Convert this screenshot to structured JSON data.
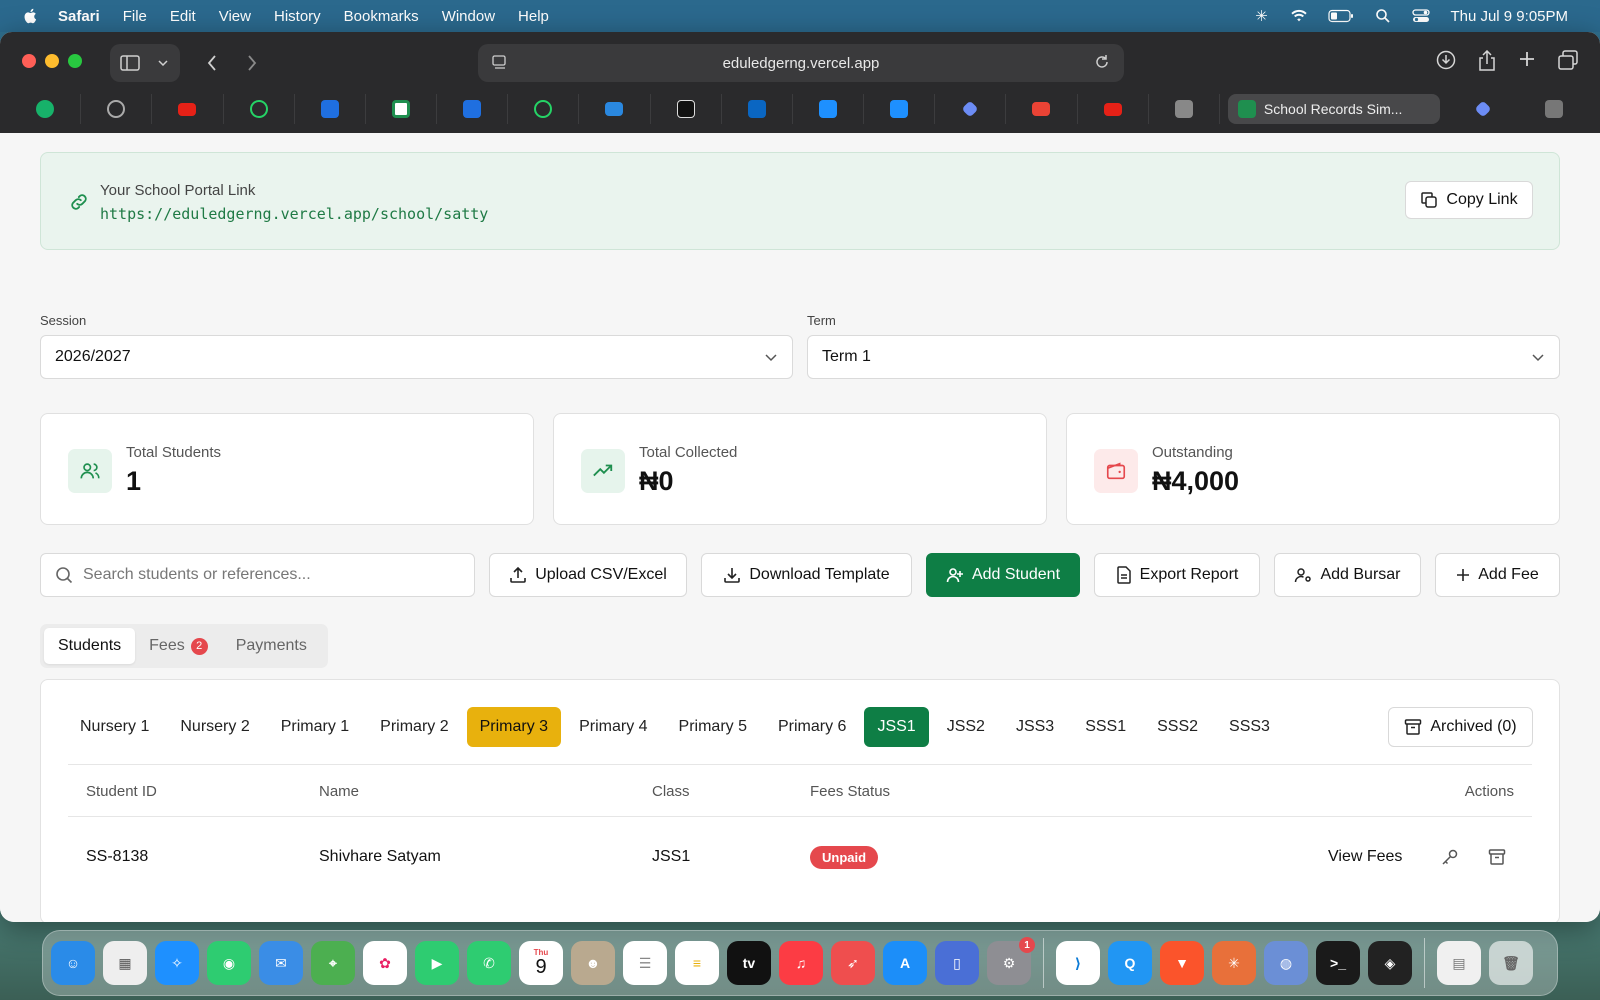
{
  "menubar": {
    "app": "Safari",
    "items": [
      "File",
      "Edit",
      "View",
      "History",
      "Bookmarks",
      "Window",
      "Help"
    ],
    "datetime": "Thu Jul 9  9:05PM"
  },
  "browser": {
    "url": "eduledgerng.vercel.app",
    "active_tab": "School Records Sim..."
  },
  "portal": {
    "label": "Your School Portal Link",
    "url": "https://eduledgerng.vercel.app/school/satty",
    "copy_label": "Copy Link"
  },
  "filters": {
    "session_label": "Session",
    "session_value": "2026/2027",
    "term_label": "Term",
    "term_value": "Term 1"
  },
  "stats": [
    {
      "label": "Total Students",
      "value": "1"
    },
    {
      "label": "Total Collected",
      "value": "₦0"
    },
    {
      "label": "Outstanding",
      "value": "₦4,000"
    }
  ],
  "actions": {
    "search_placeholder": "Search students or references...",
    "upload": "Upload CSV/Excel",
    "download_template": "Download Template",
    "add_student": "Add Student",
    "export_report": "Export Report",
    "add_bursar": "Add Bursar",
    "add_fee": "Add Fee"
  },
  "tabs": {
    "students": "Students",
    "fees": "Fees",
    "fees_badge": "2",
    "payments": "Payments"
  },
  "classes": [
    "Nursery 1",
    "Nursery 2",
    "Primary 1",
    "Primary 2",
    "Primary 3",
    "Primary 4",
    "Primary 5",
    "Primary 6",
    "JSS1",
    "JSS2",
    "JSS3",
    "SSS1",
    "SSS2",
    "SSS3"
  ],
  "archived_label": "Archived (0)",
  "table": {
    "headers": {
      "id": "Student ID",
      "name": "Name",
      "class": "Class",
      "fees": "Fees Status",
      "actions": "Actions"
    },
    "rows": [
      {
        "id": "SS-8138",
        "name": "Shivhare Satyam",
        "class": "JSS1",
        "status": "Unpaid",
        "view": "View Fees"
      }
    ]
  },
  "colors": {
    "brand_green": "#0e7e45",
    "highlight_yellow": "#e8b10d",
    "danger_red": "#e5484d"
  },
  "dock": {
    "calendar_day": "Thu",
    "calendar_date": "9",
    "settings_badge": "1"
  }
}
